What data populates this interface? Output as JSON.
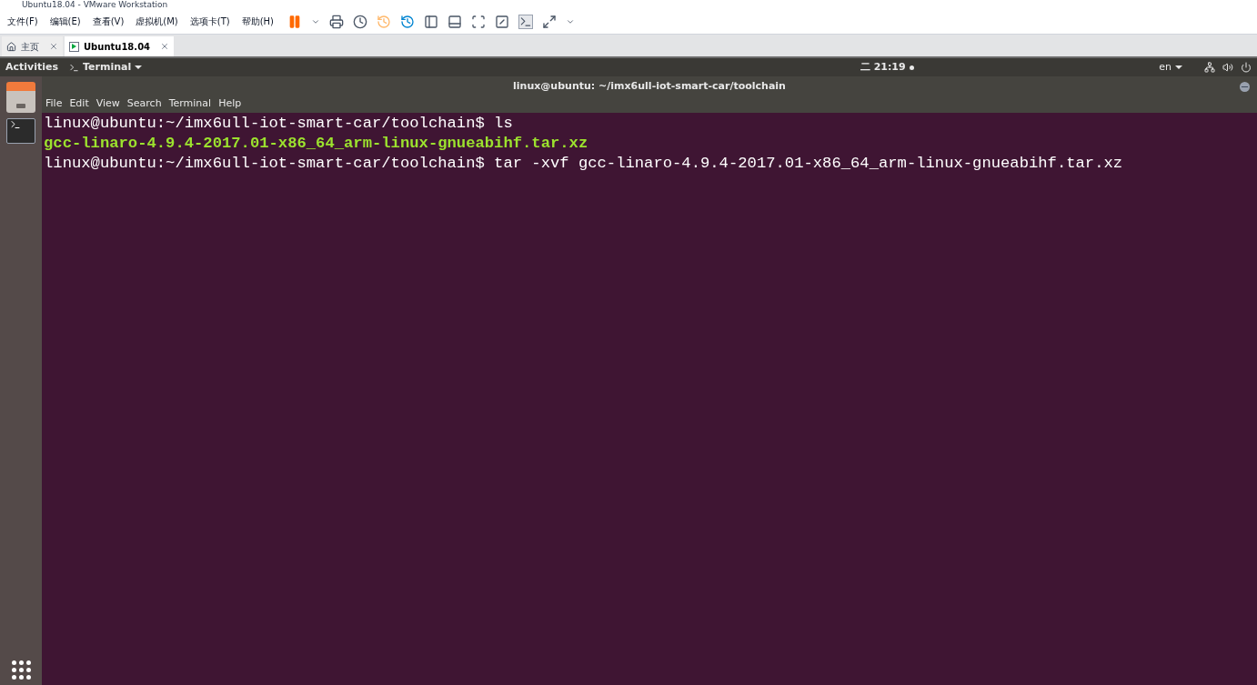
{
  "window": {
    "title": "Ubuntu18.04 - VMware Workstation"
  },
  "menu": [
    "文件(F)",
    "编辑(E)",
    "查看(V)",
    "虚拟机(M)",
    "选项卡(T)",
    "帮助(H)"
  ],
  "tabs": [
    {
      "label": "主页",
      "selected": false
    },
    {
      "label": "Ubuntu18.04",
      "selected": true
    }
  ],
  "top_bar": {
    "activities": "Activities",
    "app": "Terminal",
    "clock": "二 21:19",
    "language": "en"
  },
  "terminal": {
    "title": "linux@ubuntu: ~/imx6ull-iot-smart-car/toolchain",
    "menu": [
      "File",
      "Edit",
      "View",
      "Search",
      "Terminal",
      "Help"
    ],
    "lines": [
      {
        "kind": "prompt",
        "prompt": "linux@ubuntu:~/imx6ull-iot-smart-car/toolchain$",
        "command": "ls"
      },
      {
        "kind": "archive",
        "text": "gcc-linaro-4.9.4-2017.01-x86_64_arm-linux-gnueabihf.tar.xz"
      },
      {
        "kind": "prompt",
        "prompt": "linux@ubuntu:~/imx6ull-iot-smart-car/toolchain$",
        "command": "tar -xvf gcc-linaro-4.9.4-2017.01-x86_64_arm-linux-gnueabihf.tar.xz"
      }
    ]
  }
}
